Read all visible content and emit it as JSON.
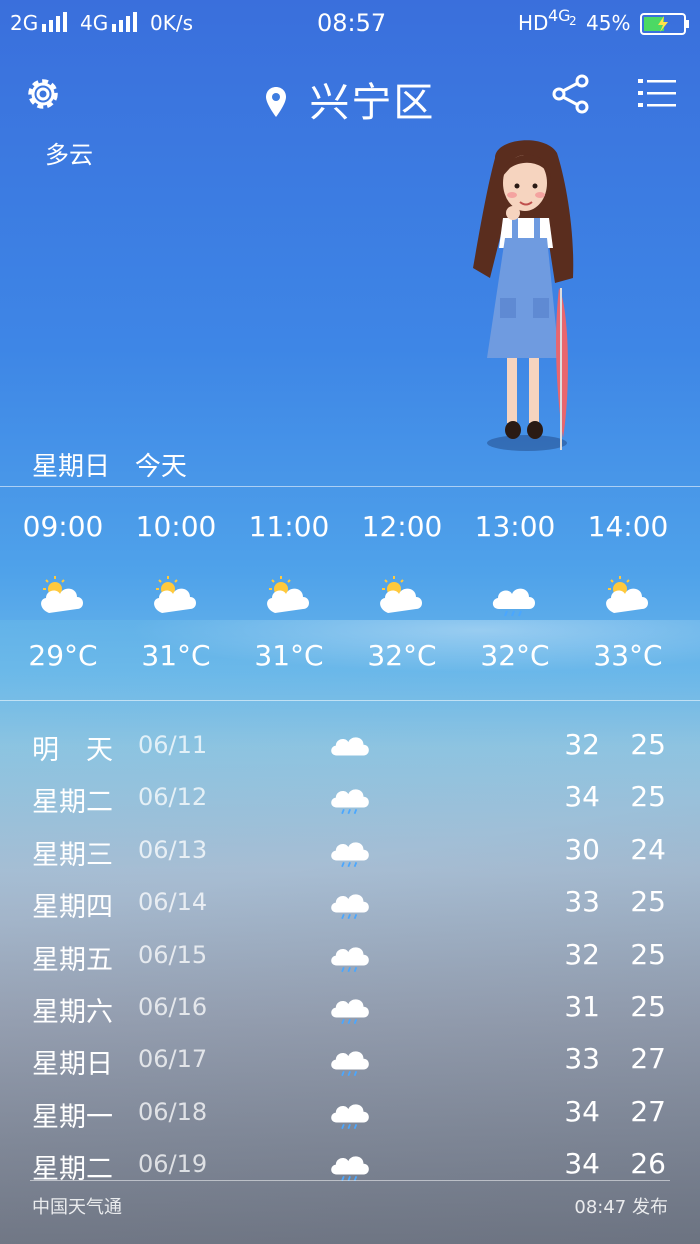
{
  "status_bar": {
    "net1": "2G",
    "net2": "4G",
    "speed": "0K/s",
    "time": "08:57",
    "hd": "HD",
    "net3": "4G",
    "sub": "2",
    "battery": "45%"
  },
  "header": {
    "location": "兴宁区"
  },
  "current": {
    "condition": "多云"
  },
  "today": {
    "weekday": "星期日",
    "label": "今天"
  },
  "hourly": [
    {
      "time": "09:00",
      "icon": "partly-cloudy-icon",
      "temp": "29°C"
    },
    {
      "time": "10:00",
      "icon": "partly-cloudy-icon",
      "temp": "31°C"
    },
    {
      "time": "11:00",
      "icon": "partly-cloudy-icon",
      "temp": "31°C"
    },
    {
      "time": "12:00",
      "icon": "partly-cloudy-icon",
      "temp": "32°C"
    },
    {
      "time": "13:00",
      "icon": "rain-icon",
      "temp": "32°C"
    },
    {
      "time": "14:00",
      "icon": "partly-cloudy-icon",
      "temp": "33°C"
    }
  ],
  "daily": [
    {
      "day": "明　天",
      "date": "06/11",
      "icon": "cloudy-icon",
      "hi": "32",
      "lo": "25"
    },
    {
      "day": "星期二",
      "date": "06/12",
      "icon": "rain-icon",
      "hi": "34",
      "lo": "25"
    },
    {
      "day": "星期三",
      "date": "06/13",
      "icon": "rain-icon",
      "hi": "30",
      "lo": "24"
    },
    {
      "day": "星期四",
      "date": "06/14",
      "icon": "rain-icon",
      "hi": "33",
      "lo": "25"
    },
    {
      "day": "星期五",
      "date": "06/15",
      "icon": "rain-icon",
      "hi": "32",
      "lo": "25"
    },
    {
      "day": "星期六",
      "date": "06/16",
      "icon": "rain-icon",
      "hi": "31",
      "lo": "25"
    },
    {
      "day": "星期日",
      "date": "06/17",
      "icon": "rain-icon",
      "hi": "33",
      "lo": "27"
    },
    {
      "day": "星期一",
      "date": "06/18",
      "icon": "rain-icon",
      "hi": "34",
      "lo": "27"
    },
    {
      "day": "星期二",
      "date": "06/19",
      "icon": "rain-icon",
      "hi": "34",
      "lo": "26"
    }
  ],
  "footer": {
    "source": "中国天气通",
    "published": "08:47 发布"
  }
}
